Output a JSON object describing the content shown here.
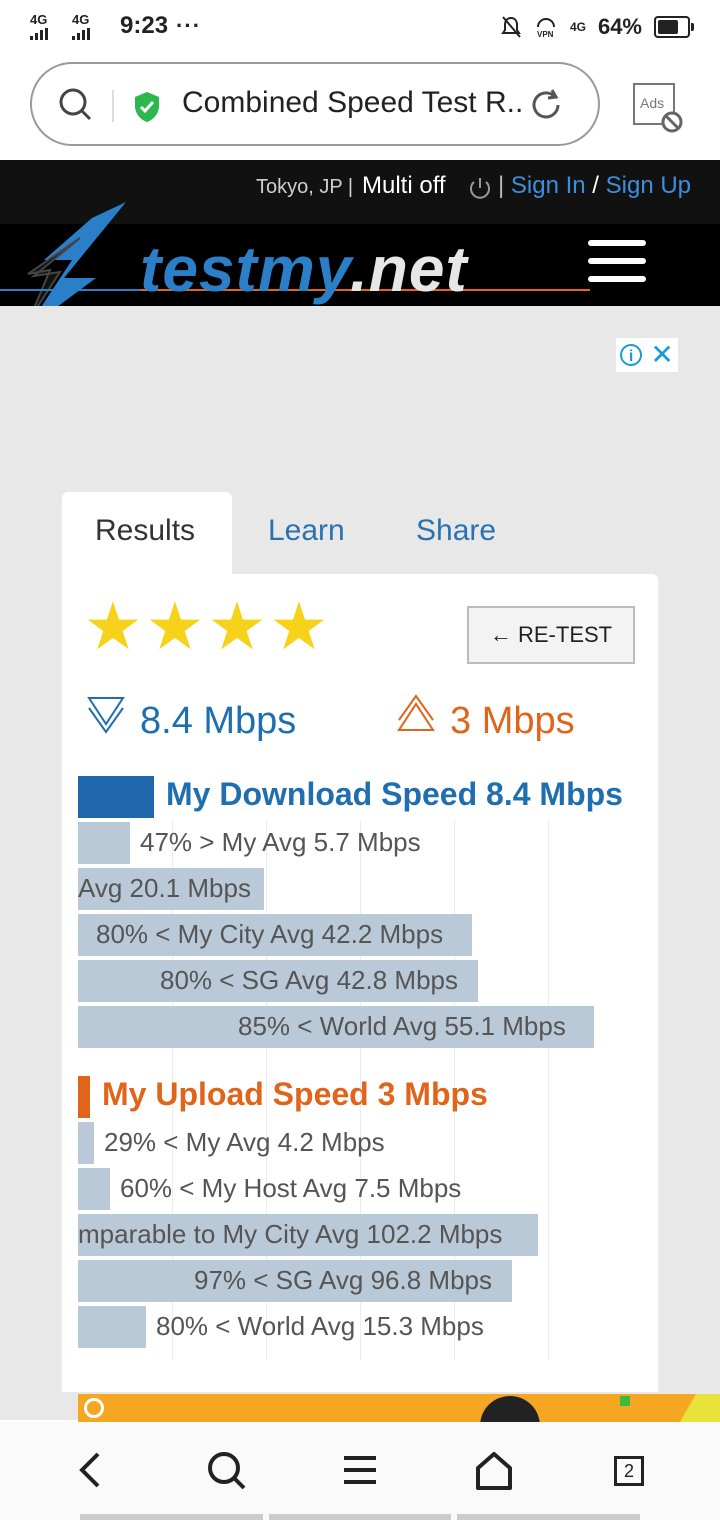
{
  "status_bar": {
    "signal1": "4G",
    "signal2": "4G",
    "time": "9:23",
    "more": "···",
    "battery_pct": "64%",
    "net_badge": "4G"
  },
  "browser": {
    "title": "Combined Speed Test R...",
    "ads_label": "Ads"
  },
  "site": {
    "location": "Tokyo, JP",
    "sep": "|",
    "multi": "Multi off",
    "sign_in": "Sign In",
    "slash": "/",
    "sign_up": "Sign Up",
    "logo_main": "testmy",
    "logo_tld": ".net"
  },
  "tabs": {
    "results": "Results",
    "learn": "Learn",
    "share": "Share"
  },
  "rating": {
    "stars": 4,
    "max": 4
  },
  "retest_label": "← RE-TEST",
  "summary": {
    "download": "8.4 Mbps",
    "upload": "3 Mbps"
  },
  "chart_data": {
    "type": "bar",
    "download": {
      "title": "My Download Speed 8.4 Mbps",
      "rows": [
        {
          "label": "47% > My Avg 5.7 Mbps",
          "value": 5.7
        },
        {
          "label": "Avg 20.1 Mbps",
          "value": 20.1
        },
        {
          "label": "80% < My City Avg 42.2 Mbps",
          "value": 42.2
        },
        {
          "label": "80% < SG Avg 42.8 Mbps",
          "value": 42.8
        },
        {
          "label": "85% < World Avg 55.1 Mbps",
          "value": 55.1
        }
      ]
    },
    "upload": {
      "title": "My Upload Speed 3 Mbps",
      "rows": [
        {
          "label": "29% < My Avg 4.2 Mbps",
          "value": 4.2
        },
        {
          "label": "60% < My Host Avg 7.5 Mbps",
          "value": 7.5
        },
        {
          "label": "mparable to My City Avg 102.2 Mbps",
          "value": 102.2
        },
        {
          "label": "97% < SG Avg 96.8 Mbps",
          "value": 96.8
        },
        {
          "label": "80% < World Avg 15.3 Mbps",
          "value": 15.3
        }
      ]
    }
  },
  "bottom_nav": {
    "tab_count": "2"
  }
}
